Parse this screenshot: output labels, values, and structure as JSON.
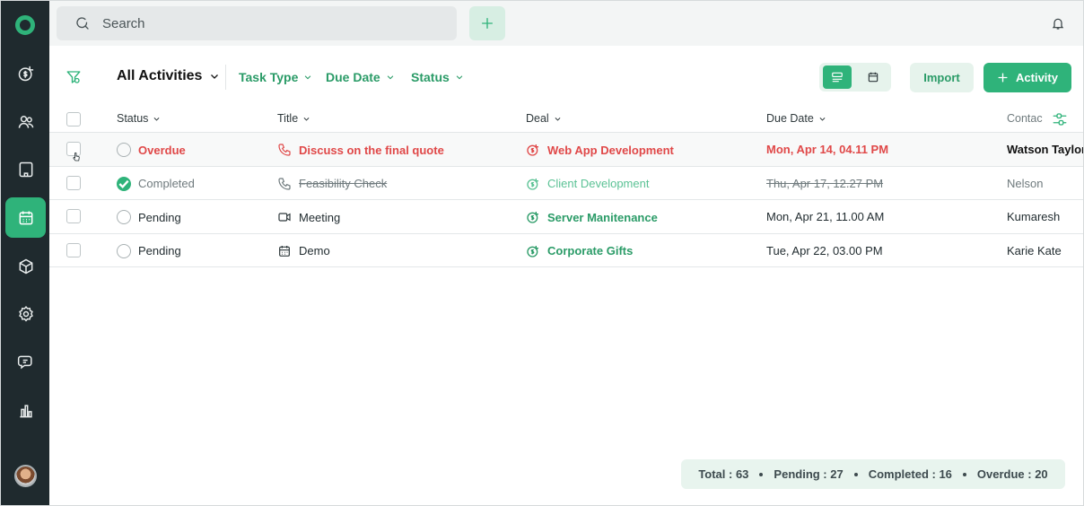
{
  "search": {
    "placeholder": "Search"
  },
  "toolbar": {
    "view_title": "All Activities",
    "filters": [
      "Task Type",
      "Due Date",
      "Status"
    ],
    "import_label": "Import",
    "activity_label": "Activity"
  },
  "table": {
    "headers": {
      "status": "Status",
      "title": "Title",
      "deal": "Deal",
      "due_date": "Due Date",
      "contact": "Contac"
    },
    "rows": [
      {
        "status": "Overdue",
        "title": "Discuss on the final quote",
        "deal": "Web App Development",
        "due_date": "Mon, Apr 14, 04.11 PM",
        "contact": "Watson Taylor"
      },
      {
        "status": "Completed",
        "title": "Feasibility Check",
        "deal": "Client Development",
        "due_date": "Thu, Apr 17, 12.27 PM",
        "contact": "Nelson"
      },
      {
        "status": "Pending",
        "title": "Meeting",
        "deal": "Server Manitenance",
        "due_date": "Mon, Apr 21, 11.00 AM",
        "contact": "Kumaresh"
      },
      {
        "status": "Pending",
        "title": "Demo",
        "deal": "Corporate Gifts",
        "due_date": "Tue, Apr 22, 03.00 PM",
        "contact": "Karie Kate"
      }
    ]
  },
  "summary": {
    "total": "Total : 63",
    "pending": "Pending : 27",
    "completed": "Completed : 16",
    "overdue": "Overdue : 20"
  },
  "colors": {
    "sidebar_bg": "#1f2a2e",
    "accent": "#2fb37a",
    "overdue": "#e04848"
  }
}
